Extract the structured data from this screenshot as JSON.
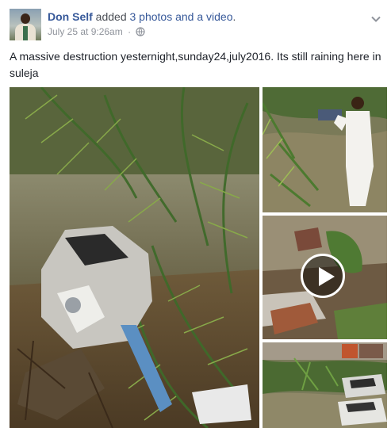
{
  "post": {
    "author": "Don Self",
    "action_prefix": "added",
    "action_link": "3 photos and a video",
    "action_suffix": ".",
    "timestamp": "July 25 at 9:26am",
    "separator": "·",
    "privacy_icon": "globe-icon",
    "menu_icon": "chevron-down-icon",
    "text": "A massive destruction yesternight,sunday24,july2016. Its still raining here in suleja"
  },
  "media": {
    "photo_count": 3,
    "video_count": 1,
    "play_icon": "play-icon"
  },
  "colors": {
    "link": "#365899",
    "meta": "#90949c",
    "text": "#1d2129",
    "headline": "#4b4f56"
  }
}
